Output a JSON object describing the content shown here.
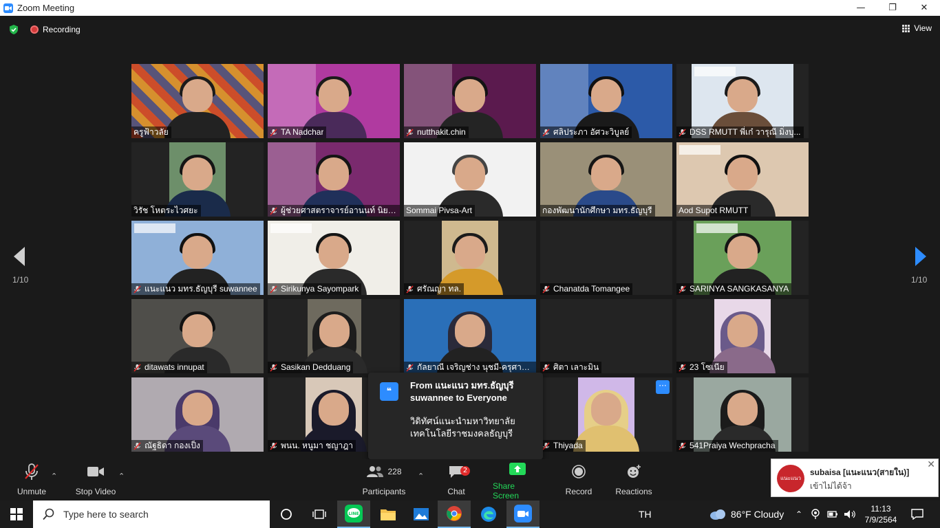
{
  "window": {
    "title": "Zoom Meeting",
    "minimize": "—",
    "restore": "❐",
    "close": "✕"
  },
  "meeting": {
    "recording_label": "Recording",
    "view_label": "View",
    "page_left": "1/10",
    "page_right": "1/10"
  },
  "participants": [
    {
      "name": "ครูฟ้าวลัย",
      "muted": false
    },
    {
      "name": "TA Nadchar",
      "muted": true
    },
    {
      "name": "nutthakit.chin",
      "muted": true
    },
    {
      "name": "ศลิประภา อัศวะวิบูลย์",
      "muted": true
    },
    {
      "name": "DSS RMUTT พี่เก๋ วารุณี มิ่งบุ...",
      "muted": true
    },
    {
      "name": "วิรัช  โหตระไวศยะ",
      "muted": false
    },
    {
      "name": "ผู้ช่วยศาสตราจารย์อานนท์ นิยม...",
      "muted": true
    },
    {
      "name": "Sommai Pivsa-Art",
      "muted": false
    },
    {
      "name": "กองพัฒนานักศึกษา มทร.ธัญบุรี",
      "muted": false
    },
    {
      "name": "Aod Supot RMUTT",
      "muted": false
    },
    {
      "name": "แนะแนว มทร.ธัญบุรี suwannee",
      "muted": true
    },
    {
      "name": "Sirikunya Sayompark",
      "muted": true
    },
    {
      "name": "ศรัณญา ทล.",
      "muted": true
    },
    {
      "name": "Chanatda Tomangee",
      "muted": true
    },
    {
      "name": "SARINYA SANGKASANYA",
      "muted": true
    },
    {
      "name": "ditawats innupat",
      "muted": true
    },
    {
      "name": "Sasikan Dedduang",
      "muted": true
    },
    {
      "name": "กัลยาณี เจริญช่าง นุชมี-ครุศาส...",
      "muted": true
    },
    {
      "name": "ศิตา เลาะมิน",
      "muted": true
    },
    {
      "name": "23 โซเนีย",
      "muted": true
    },
    {
      "name": "ณัฐธิดา กองเป็ง",
      "muted": true
    },
    {
      "name": "พนน. หนูมา ชญาฎา",
      "muted": true
    },
    {
      "name": "",
      "muted": false
    },
    {
      "name": "Thiyada",
      "muted": true
    },
    {
      "name": "541Praiya Wechpracha",
      "muted": true
    }
  ],
  "chat_popup": {
    "quote_icon": "❝",
    "from": "From แนะแนว มทร.ธัญบุรี suwannee to Everyone",
    "message": "วิดิทัศน์แนะนำมหาวิทยาลัยเทคโนโลยีราชมงคลธัญบุรี"
  },
  "more_button": "···",
  "controls": {
    "unmute": "Unmute",
    "stop_video": "Stop Video",
    "participants_count": "228",
    "participants": "Participants",
    "chat": "Chat",
    "chat_badge": "2",
    "share_screen": "Share Screen",
    "record": "Record",
    "reactions": "Reactions",
    "caret": "⌃"
  },
  "notification": {
    "sender": "subaisa [แนะแนว(สายใน)]",
    "text": "เข้าไม่ได้จ้า",
    "logo_text": "แนะแนว",
    "close": "✕"
  },
  "taskbar": {
    "search_placeholder": "Type here to search",
    "language": "TH",
    "weather": "86°F  Cloudy",
    "time": "11:13",
    "date": "7/9/2564"
  },
  "colors": {
    "accent": "#2d8cff",
    "speaking": "#e9ec5b",
    "share_green": "#23d959",
    "badge_red": "#e02b2b",
    "background": "#1a1a1a"
  }
}
